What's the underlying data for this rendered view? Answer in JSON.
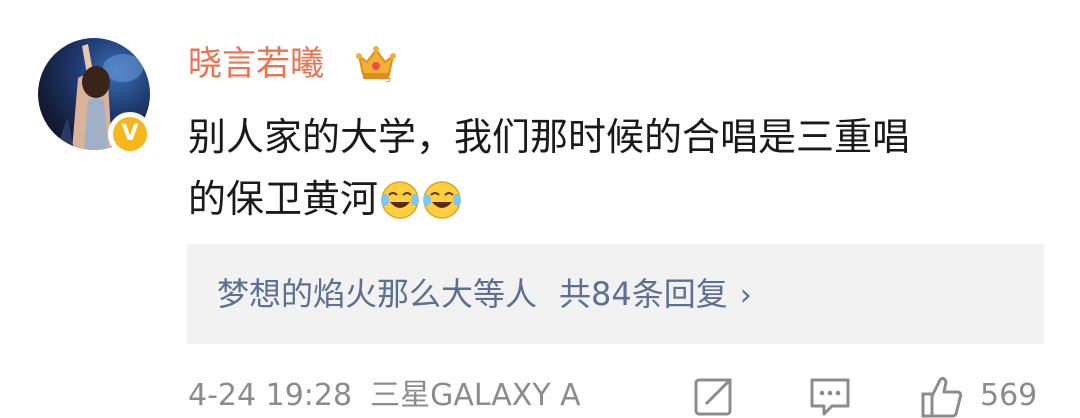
{
  "post": {
    "username": "晓言若曦",
    "comment_line1": "别人家的大学，我们那时候的合唱是三重唱",
    "comment_line2": "的保卫黄河",
    "verified_mark": "V"
  },
  "reply_preview": {
    "text": "梦想的焰火那么大等人",
    "count_label": "共84条回复",
    "chevron": "›"
  },
  "footer": {
    "time": "4-24 19:28",
    "device": "三星GALAXY A",
    "likes": "569"
  },
  "icons": [
    "avatar",
    "verified-badge-icon",
    "crown-icon",
    "laugh-cry-emoji-icon",
    "repost-icon",
    "comment-icon",
    "like-icon"
  ],
  "colors": {
    "username": "#eb7350",
    "reply_text": "#5d6f92",
    "reply_bg": "#f2f2f2",
    "meta": "#8c8c8c",
    "verified": "#f7b61b"
  }
}
